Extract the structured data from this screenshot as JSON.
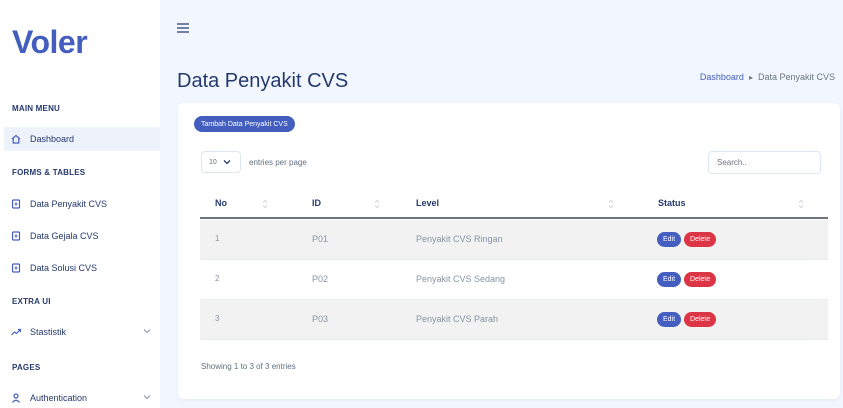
{
  "sidebar": {
    "logo": "Voler",
    "sections": {
      "main": "MAIN MENU",
      "forms": "FORMS & TABLES",
      "extra": "EXTRA UI",
      "pages": "PAGES"
    },
    "items": [
      {
        "label": "Dashboard",
        "icon": "home-icon",
        "active": true
      },
      {
        "label": "Data Penyakit CVS",
        "icon": "file-plus-icon"
      },
      {
        "label": "Data Gejala CVS",
        "icon": "file-plus-icon"
      },
      {
        "label": "Data Solusi CVS",
        "icon": "file-plus-icon"
      },
      {
        "label": "Stastistik",
        "icon": "trending-up-icon",
        "has_submenu": true
      },
      {
        "label": "Authentication",
        "icon": "user-icon",
        "has_submenu": true
      }
    ]
  },
  "header": {
    "title": "Data Penyakit CVS",
    "breadcrumb": {
      "link": "Dashboard",
      "current": "Data Penyakit CVS"
    }
  },
  "card": {
    "add_button": "Tambah Data Penyakit CVS",
    "per_page_value": "10",
    "per_page_label": "entries per page",
    "search_placeholder": "Search..",
    "columns": [
      "No",
      "ID",
      "Level",
      "Status"
    ],
    "rows": [
      {
        "no": "1",
        "id": "P01",
        "level": "Penyakit CVS Ringan",
        "edit": "Edit",
        "delete": "Delete"
      },
      {
        "no": "2",
        "id": "P02",
        "level": "Penyakit CVS Sedang",
        "edit": "Edit",
        "delete": "Delete"
      },
      {
        "no": "3",
        "id": "P03",
        "level": "Penyakit CVS Parah",
        "edit": "Edit",
        "delete": "Delete"
      }
    ],
    "footer_info": "Showing 1 to 3 of 3 entries"
  },
  "colors": {
    "primary": "#435ebe",
    "danger": "#dc3545",
    "background": "#f2f7ff",
    "text": "#25396f"
  }
}
